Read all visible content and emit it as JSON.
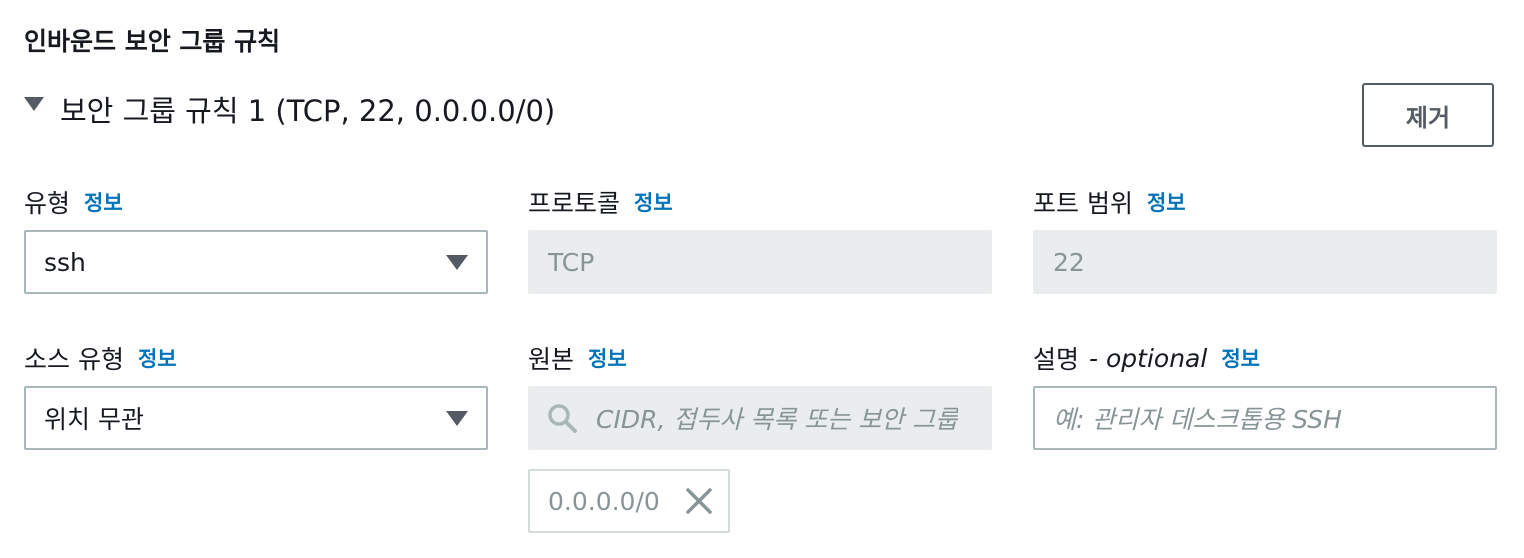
{
  "section": {
    "title": "인바운드 보안 그룹 규칙"
  },
  "rule": {
    "title": "보안 그룹 규칙 1 (TCP, 22, 0.0.0.0/0)",
    "remove_label": "제거",
    "expanded": true
  },
  "fields": {
    "type": {
      "label": "유형",
      "info": "정보",
      "value": "ssh"
    },
    "protocol": {
      "label": "프로토콜",
      "info": "정보",
      "value": "TCP"
    },
    "port_range": {
      "label": "포트 범위",
      "info": "정보",
      "value": "22"
    },
    "source_type": {
      "label": "소스 유형",
      "info": "정보",
      "value": "위치 무관"
    },
    "source": {
      "label": "원본",
      "info": "정보",
      "placeholder": "CIDR, 접두사 목록 또는 보안 그룹",
      "tokens": [
        "0.0.0.0/0"
      ]
    },
    "description": {
      "label": "설명",
      "optional": "- optional",
      "info": "정보",
      "placeholder": "예: 관리자 데스크톱용 SSH"
    }
  },
  "colors": {
    "link": "#0073bb",
    "text": "#16191f",
    "muted": "#879596",
    "border": "#aab7b8",
    "disabled_bg": "#eaeded",
    "button_border": "#545b64"
  },
  "icons": {
    "rule_toggle": "caret-down-icon",
    "select_arrow": "caret-down-icon",
    "search": "search-icon",
    "token_dismiss": "close-icon"
  }
}
